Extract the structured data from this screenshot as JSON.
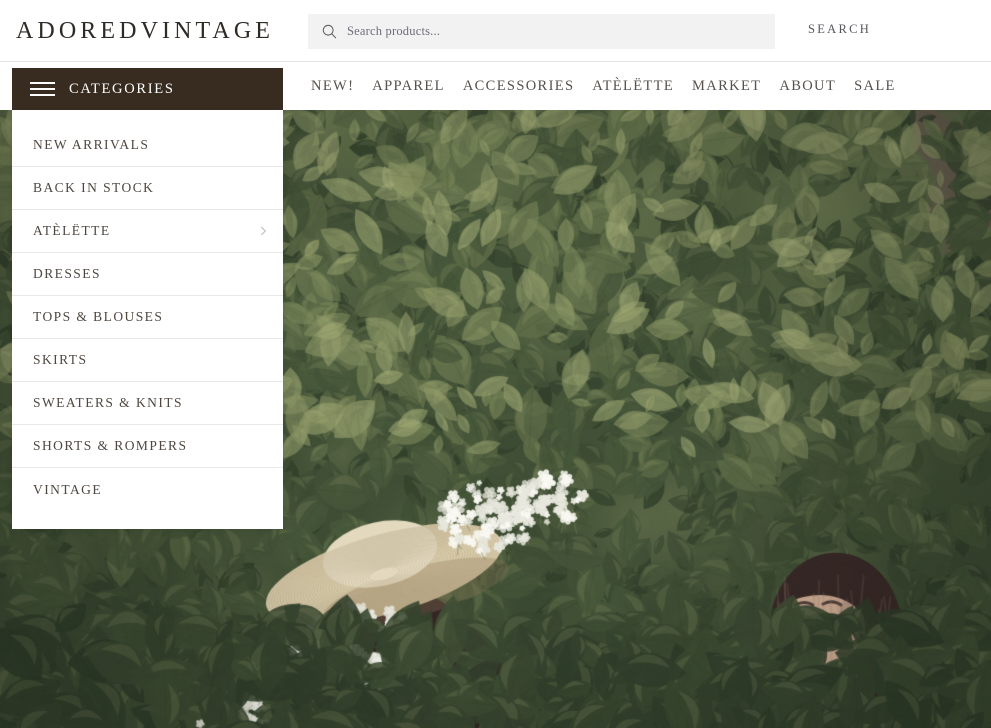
{
  "header": {
    "logo": "ADOREDVINTAGE",
    "search": {
      "icon": "search-icon",
      "placeholder": "Search products...",
      "value": "",
      "submit_label": "SEARCH"
    }
  },
  "nav_bar": {
    "categories_button": {
      "icon": "hamburger-icon",
      "label": "CATEGORIES",
      "background": "#382b20",
      "text_color": "#ffffff"
    },
    "links": [
      {
        "label": "NEW!"
      },
      {
        "label": "APPAREL"
      },
      {
        "label": "ACCESSORIES"
      },
      {
        "label": "ATÈLËTTE"
      },
      {
        "label": "MARKET"
      },
      {
        "label": "ABOUT"
      },
      {
        "label": "SALE"
      }
    ]
  },
  "categories_dropdown": {
    "open": true,
    "items": [
      {
        "label": "NEW ARRIVALS",
        "has_submenu": false
      },
      {
        "label": "BACK IN STOCK",
        "has_submenu": false
      },
      {
        "label": "ATÈLËTTE",
        "has_submenu": true
      },
      {
        "label": "DRESSES",
        "has_submenu": false
      },
      {
        "label": "TOPS & BLOUSES",
        "has_submenu": false
      },
      {
        "label": "SKIRTS",
        "has_submenu": false
      },
      {
        "label": "SWEATERS & KNITS",
        "has_submenu": false
      },
      {
        "label": "SHORTS & ROMPERS",
        "has_submenu": false
      },
      {
        "label": "VINTAGE",
        "has_submenu": false
      }
    ]
  },
  "hero": {
    "description": "Two women outdoors in front of a dense green hedge; one on the left wears a wide-brim straw hat and holds white blossoms, one on the right wears a white floral-print dress",
    "colors": {
      "foliage_dark": "#2f3d2a",
      "foliage_mid": "#4a5a3c",
      "foliage_light": "#7e8a5c",
      "highlight": "#b8bf86",
      "skin": "#d8b49a",
      "hair": "#3a2a28",
      "dress": "#f2eee6",
      "hat": "#d8cbaa",
      "wall": "#6d5f55"
    }
  },
  "theme": {
    "accent_brown": "#382b20",
    "text": "#4e4740",
    "search_bg": "#f2f2f2",
    "divider": "#e8e8e8"
  }
}
